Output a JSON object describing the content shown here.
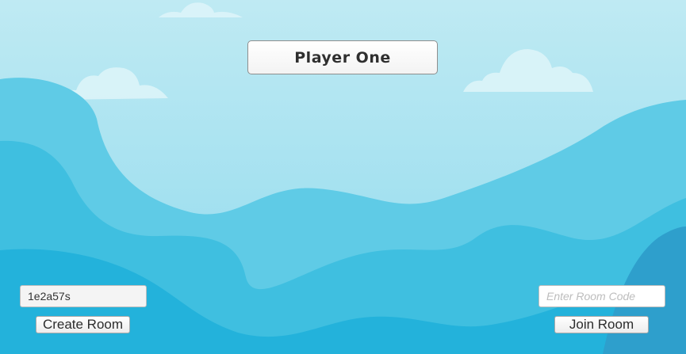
{
  "player": {
    "name": "Player One"
  },
  "create": {
    "room_code_value": "1e2a57s",
    "button_label": "Create Room"
  },
  "join": {
    "placeholder": "Enter Room Code",
    "button_label": "Join Room"
  },
  "colors": {
    "sky_top": "#bfeaf3",
    "sky_bottom": "#8fdaee",
    "hill_far": "#5fcbe6",
    "hill_mid": "#3fbfe0",
    "hill_near": "#23b2db",
    "hill_dark": "#2e9fcc",
    "cloud": "#def4f9"
  }
}
